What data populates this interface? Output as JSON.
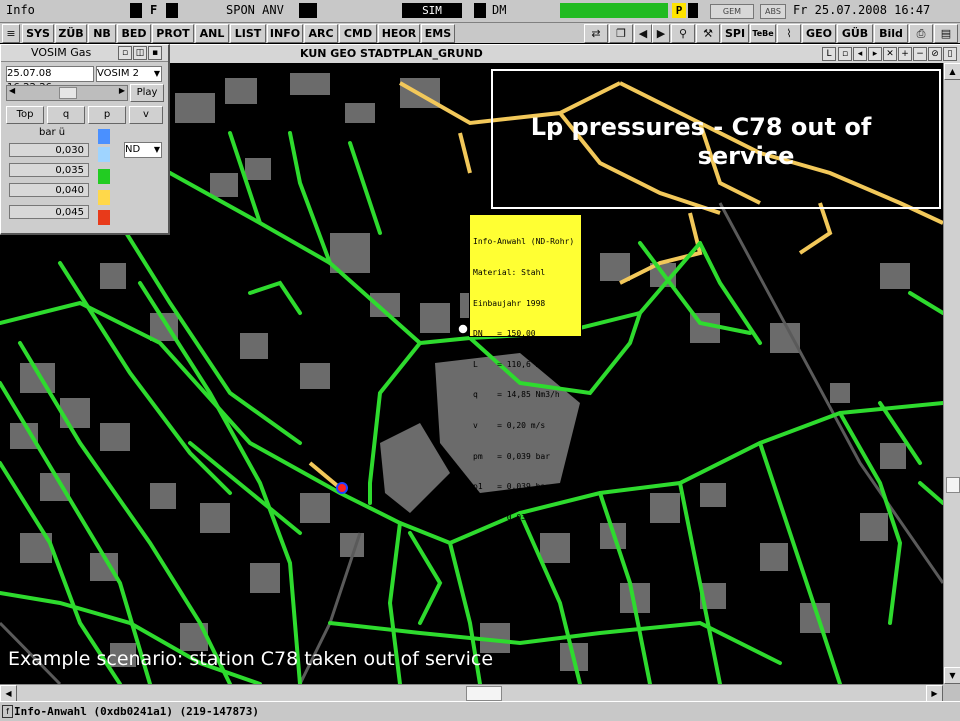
{
  "statusbar": {
    "info": "Info",
    "f": "F",
    "spon": "SPON ANV",
    "sim": "SIM",
    "dm": "DM",
    "p": "P",
    "gem": "GEM",
    "abs": "ABS",
    "datetime": "Fr 25.07.2008 16:47"
  },
  "menubar": {
    "items": [
      "SYS",
      "ZÜB",
      "NB",
      "BED",
      "PROT",
      "ANL",
      "LIST",
      "INFO",
      "ARC",
      "CMD",
      "HEOR",
      "EMS"
    ],
    "right_items": [
      "SPI",
      "TeBe",
      "GEO",
      "GÜB",
      "Bild"
    ]
  },
  "map_window": {
    "title": "KUN GEO STADTPLAN_GRUND",
    "l_button": "L"
  },
  "vosim": {
    "title": "VOSIM Gas",
    "datetime": "25.07.08 16:22:26",
    "mode": "VOSIM 2",
    "play": "Play",
    "buttons": [
      "Top",
      "q",
      "p",
      "v"
    ],
    "unit": "bar ü",
    "legend_values": [
      "0,030",
      "0,035",
      "0,040",
      "0,045"
    ],
    "legend_colors": [
      "#4a90ff",
      "#9fd4ff",
      "#22cc22",
      "#ffd84a",
      "#e83a1a"
    ],
    "nd_select": "ND"
  },
  "overlay": {
    "title_line1": "Lp pressures - C78 out of",
    "title_line2": "service",
    "caption": "Example scenario: station C78 taken out of service"
  },
  "infobox": {
    "lines": [
      "Info-Anwahl (ND-Rohr)",
      "Material: Stahl",
      "Einbaujahr 1998",
      "DN   = 150,00",
      "L    = 110,6 m",
      "q    = 14,85 Nm3/h",
      "v    = 0,20 m/s",
      "pm   = 0,039 bar",
      "p1   = 0,039 bar",
      "p2   = 0,039 bar"
    ]
  },
  "bottombar": {
    "text": "Info-Anwahl (0xdb0241a1) (219-147873)"
  },
  "colors": {
    "pipe_green": "#2edb2e",
    "pipe_yellow": "#f2c85a",
    "building_gray": "#6b6b6b"
  }
}
